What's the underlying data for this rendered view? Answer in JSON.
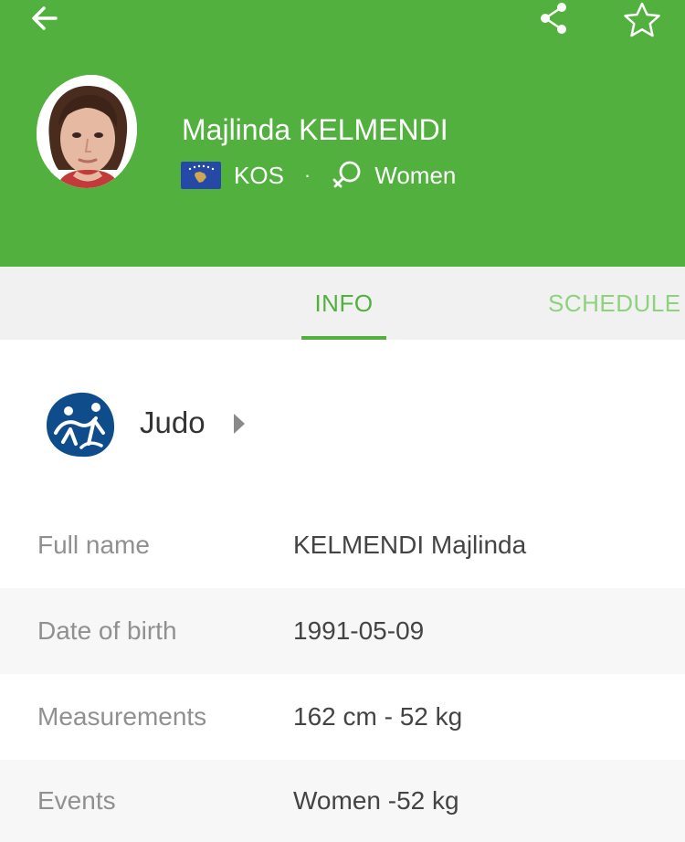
{
  "header": {
    "background_color": "#52b03e",
    "back_icon": "arrow-left-icon",
    "share_icon": "share-icon",
    "favorite_icon": "star-outline-icon",
    "athlete": {
      "name": "Majlinda KELMENDI",
      "country_code": "KOS",
      "flag_icon": "kosovo-flag-icon",
      "separator": "·",
      "gender_icon": "female-symbol-icon",
      "gender": "Women"
    }
  },
  "tabs": [
    {
      "label": "INFO",
      "active": true
    },
    {
      "label": "SCHEDULE",
      "active": false
    }
  ],
  "sport": {
    "icon": "judo-pictogram-icon",
    "name": "Judo"
  },
  "details": [
    {
      "label": "Full name",
      "value": "KELMENDI Majlinda"
    },
    {
      "label": "Date of birth",
      "value": "1991-05-09"
    },
    {
      "label": "Measurements",
      "value": "162 cm - 52 kg"
    },
    {
      "label": "Events",
      "value": "Women -52 kg"
    }
  ]
}
